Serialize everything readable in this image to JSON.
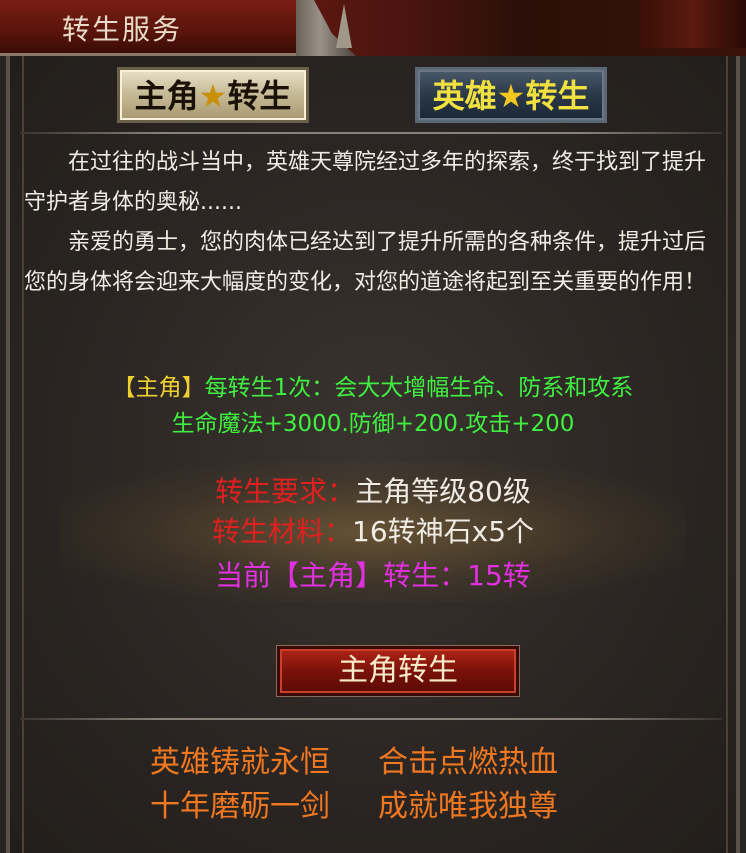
{
  "window": {
    "title": "转生服务"
  },
  "tabs": [
    {
      "label_prefix": "主角",
      "star": "★",
      "label_suffix": "转生",
      "active": true
    },
    {
      "label_prefix": "英雄",
      "star": "★",
      "label_suffix": "转生",
      "active": false
    }
  ],
  "description": {
    "paragraph1": "在过往的战斗当中，英雄天尊院经过多年的探索，终于找到了提升守护者身体的奥秘......",
    "paragraph2": "亲爱的勇士，您的肉体已经达到了提升所需的各种条件，提升过后您的身体将会迎来大幅度的变化，对您的道途将起到至关重要的作用！"
  },
  "effect": {
    "tag": "【主角】",
    "line1": "每转生1次：会大大增幅生命、防系和攻系",
    "line2": "生命魔法+3000.防御+200.攻击+200"
  },
  "requirements": {
    "level_label": "转生要求：",
    "level_value": "主角等级80级",
    "material_label": "转生材料：",
    "material_value": "16转神石x5个",
    "current_text": "当前【主角】转生：15转"
  },
  "action": {
    "label": "主角转生"
  },
  "slogans": [
    "英雄铸就永恒",
    "合击点燃热血",
    "十年磨砺一剑",
    "成就唯我独尊"
  ],
  "colors": {
    "req_label": "#e02020",
    "current": "#e030e0",
    "effect": "#40f040",
    "slogan": "#f07820",
    "tag": "#f0d030"
  }
}
